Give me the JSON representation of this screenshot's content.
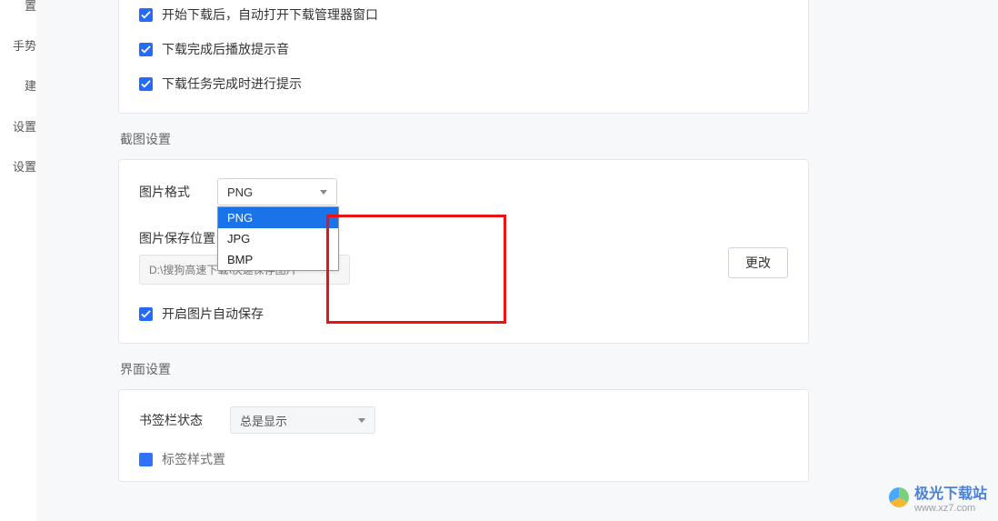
{
  "sidebar": {
    "items": [
      {
        "label": "置"
      },
      {
        "label": "手势"
      },
      {
        "label": "建"
      },
      {
        "label": "设置"
      },
      {
        "label": "设置"
      }
    ]
  },
  "download_panel": {
    "chk1": "开始下载后，自动打开下载管理器窗口",
    "chk2": "下载完成后播放提示音",
    "chk3": "下载任务完成时进行提示"
  },
  "screenshot": {
    "section_title": "截图设置",
    "format_label": "图片格式",
    "format_value": "PNG",
    "format_options": [
      "PNG",
      "JPG",
      "BMP"
    ],
    "save_label": "图片保存位置",
    "save_path": "D:\\搜狗高速下载\\快速保存图片",
    "change_btn": "更改",
    "auto_save_chk": "开启图片自动保存"
  },
  "ui": {
    "section_title": "界面设置",
    "bookmark_label": "书签栏状态",
    "bookmark_value": "总是显示",
    "next_label": "标签样式"
  },
  "watermark": {
    "title": "极光下载站",
    "url": "www.xz7.com"
  }
}
